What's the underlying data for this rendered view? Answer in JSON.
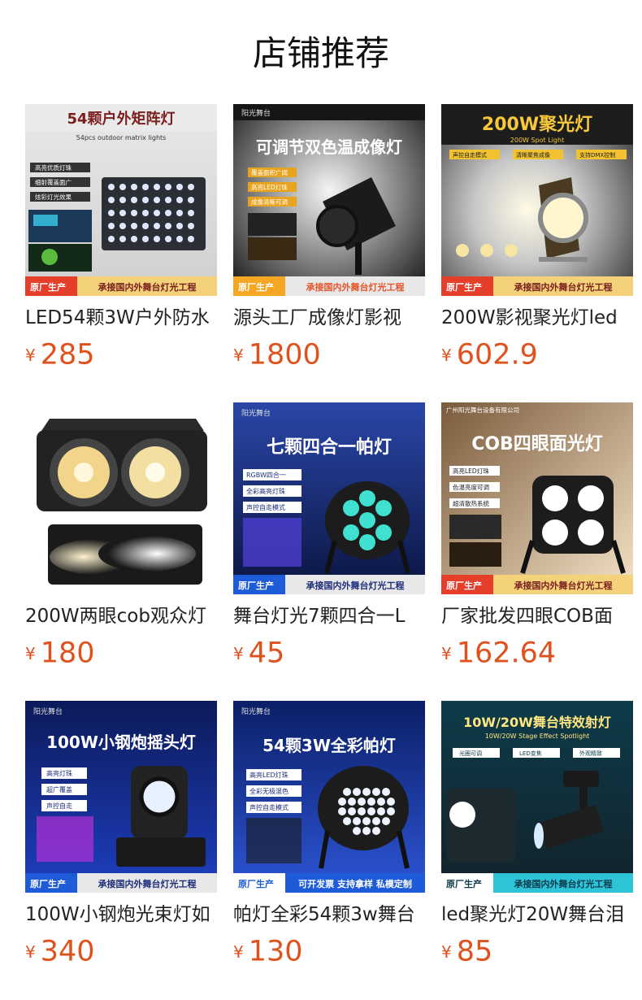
{
  "page": {
    "title": "店铺推荐"
  },
  "colors": {
    "price": "#e0521d",
    "badge_orange": "#f5a623",
    "badge_red": "#e53e2b"
  },
  "products": [
    {
      "name": "LED54颗3W户外防水",
      "currency": "¥",
      "price": "285",
      "image": {
        "headline": "54颗户外矩阵灯",
        "subline": "54pcs outdoor matrix lights",
        "tags": [
          "高亮优质灯珠",
          "细射覆盖面广",
          "炫彩灯光效果"
        ],
        "badge": "原厂生产",
        "footer": "承接国内外舞台灯光工程"
      }
    },
    {
      "name": "源头工厂成像灯影视",
      "currency": "¥",
      "price": "1800",
      "image": {
        "brand": "阳光舞台",
        "headline": "可调节双色温成像灯",
        "tags": [
          "覆盖面积广阔",
          "高亮LED灯珠",
          "成像清晰可调"
        ],
        "badge": "原厂生产",
        "footer": "承接国内外舞台灯光工程"
      }
    },
    {
      "name": "200W影视聚光灯led",
      "currency": "¥",
      "price": "602.9",
      "image": {
        "headline": "200W聚光灯",
        "subline": "200W Spot Light",
        "tags": [
          "声控自走模式",
          "清晰聚焦成像",
          "支持DMX控制"
        ],
        "badge": "原厂生产",
        "footer": "承接国内外舞台灯光工程"
      }
    },
    {
      "name": "200W两眼cob观众灯",
      "currency": "¥",
      "price": "180",
      "image": {}
    },
    {
      "name": "舞台灯光7颗四合一L",
      "currency": "¥",
      "price": "45",
      "image": {
        "brand": "阳光舞台",
        "headline": "七颗四合一帕灯",
        "tags": [
          "RGBW四合一",
          "全彩高亮灯珠",
          "声控自走模式"
        ],
        "badge": "原厂生产",
        "footer": "承接国内外舞台灯光工程"
      }
    },
    {
      "name": "厂家批发四眼COB面",
      "currency": "¥",
      "price": "162.64",
      "image": {
        "brand": "广州阳光舞台设备有限公司",
        "headline": "COB四眼面光灯",
        "tags": [
          "高亮LED灯珠",
          "色温亮度可调",
          "超清散热系统"
        ],
        "badge": "原厂生产",
        "footer": "承接国内外舞台灯光工程"
      }
    },
    {
      "name": "100W小钢炮光束灯如",
      "currency": "¥",
      "price": "340",
      "image": {
        "brand": "阳光舞台",
        "headline": "100W小钢炮摇头灯",
        "tags": [
          "高亮灯珠",
          "超广覆盖",
          "声控自走"
        ],
        "badge": "原厂生产",
        "footer": "承接国内外舞台灯光工程"
      }
    },
    {
      "name": "帕灯全彩54颗3w舞台",
      "currency": "¥",
      "price": "130",
      "image": {
        "brand": "阳光舞台",
        "headline": "54颗3W全彩帕灯",
        "tags": [
          "高亮LED灯珠",
          "全彩无极混色",
          "声控自走模式"
        ],
        "badge": "原厂生产",
        "footer": "可开发票 支持拿样 私模定制"
      }
    },
    {
      "name": "led聚光灯20W舞台泪",
      "currency": "¥",
      "price": "85",
      "image": {
        "headline": "10W/20W舞台特效射灯",
        "subline": "10W/20W Stage Effect Spotlight",
        "tags": [
          "光圈可调",
          "LED变焦",
          "外观精致"
        ],
        "badge": "原厂生产",
        "footer": "承接国内外舞台灯光工程"
      }
    }
  ]
}
